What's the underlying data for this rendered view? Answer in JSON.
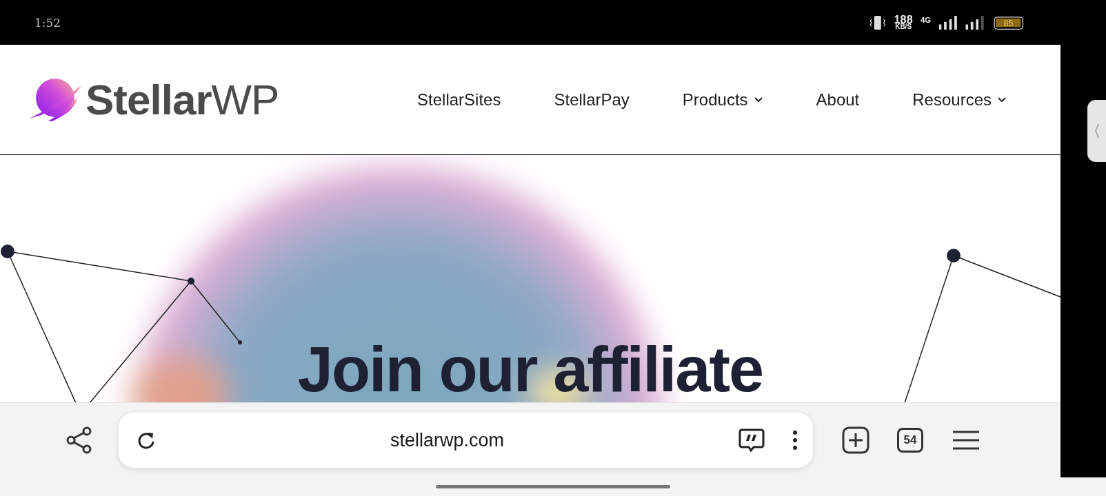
{
  "status_bar": {
    "time": "1:52",
    "speed": "188",
    "speed_unit": "KB/S",
    "network": "4G",
    "battery": "85"
  },
  "header": {
    "logo": "**Stellar**WP",
    "nav": [
      {
        "label": "StellarSites",
        "dropdown": false
      },
      {
        "label": "StellarPay",
        "dropdown": false
      },
      {
        "label": "Products",
        "dropdown": true
      },
      {
        "label": "About",
        "dropdown": false
      },
      {
        "label": "Resources",
        "dropdown": true
      }
    ]
  },
  "hero": {
    "heading": "Join our affiliate"
  },
  "browser_bar": {
    "url": "stellarwp.com",
    "tab_count": "54"
  }
}
